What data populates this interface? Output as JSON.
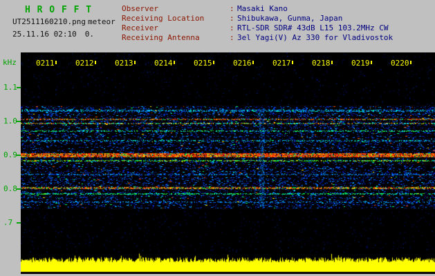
{
  "header": {
    "app_title": "H R O F F T",
    "filename": "UT2511160210.png",
    "mode": "meteor",
    "timestamp": "25.11.16 02:10",
    "counter": "0.",
    "info": [
      {
        "label": "Observer",
        "sep": ":",
        "value": "Masaki Kano"
      },
      {
        "label": "Receiving Location",
        "sep": ":",
        "value": "Shibukawa, Gunma, Japan"
      },
      {
        "label": "Receiver",
        "sep": ":",
        "value": "RTL-SDR SDR# 43dB L15 103.2MHz CW"
      },
      {
        "label": "Receiving Antenna",
        "sep": ":",
        "value": "3el Yagi(V) Az 330 for Vladivostok"
      }
    ]
  },
  "spectrogram": {
    "unit_label": "kHz",
    "y_ticks": [
      {
        "label": "1.1",
        "khz": 1.1
      },
      {
        "label": "1.0",
        "khz": 1.0
      },
      {
        "label": "0.9",
        "khz": 0.9
      },
      {
        "label": "0.8",
        "khz": 0.8
      },
      {
        "label": ".7",
        "khz": 0.7
      }
    ],
    "time_labels": [
      "0211",
      "0212",
      "0213",
      "0214",
      "0215",
      "0216",
      "0217",
      "0218",
      "0219",
      "0220"
    ],
    "colors": {
      "plot_background": "#000000",
      "axis_text": "#00a400",
      "time_text": "#ffff00",
      "signal_trace": "#ffff00"
    },
    "freq_axis_khz": {
      "top": 1.204,
      "bottom": 0.612
    },
    "noise_band_khz": {
      "high": 1.045,
      "low": 0.742
    },
    "carriers": [
      {
        "khz": 1.032,
        "thickness": 3,
        "prob": 0.5,
        "palette": [
          "#0066ff",
          "#00aaff",
          "#00ddff",
          "#0044dd",
          "#00ff99"
        ]
      },
      {
        "khz": 1.006,
        "thickness": 2,
        "prob": 0.55,
        "palette": [
          "#ff4400",
          "#ff7700",
          "#ffaa00",
          "#00ff66",
          "#ff2a00"
        ]
      },
      {
        "khz": 0.994,
        "thickness": 2,
        "prob": 0.5,
        "palette": [
          "#ff5500",
          "#ffcc00",
          "#00ff66",
          "#00ddff"
        ]
      },
      {
        "khz": 0.972,
        "thickness": 2,
        "prob": 0.45,
        "palette": [
          "#00ee66",
          "#33ff33",
          "#00ccff"
        ]
      },
      {
        "khz": 0.942,
        "thickness": 2,
        "prob": 0.4,
        "palette": [
          "#0077ff",
          "#00ccff",
          "#00ff99"
        ]
      },
      {
        "khz": 0.9,
        "thickness": 6,
        "prob": 0.82,
        "palette": [
          "#ff2a00",
          "#ff2a00",
          "#ff2a00",
          "#dd1c00",
          "#ff6600",
          "#ff9900",
          "#ffd000",
          "#00ff55"
        ]
      },
      {
        "khz": 0.884,
        "thickness": 2,
        "prob": 0.55,
        "palette": [
          "#00ff55",
          "#66ff00",
          "#00cc88",
          "#ffee00"
        ]
      },
      {
        "khz": 0.842,
        "thickness": 2,
        "prob": 0.35,
        "palette": [
          "#0088ff",
          "#00ccff",
          "#0055dd"
        ]
      },
      {
        "khz": 0.802,
        "thickness": 3,
        "prob": 0.6,
        "palette": [
          "#ff3300",
          "#ff7700",
          "#ffbb00",
          "#00ff55"
        ]
      },
      {
        "khz": 0.786,
        "thickness": 2,
        "prob": 0.5,
        "palette": [
          "#00ff66",
          "#00ddff",
          "#33ff33"
        ]
      },
      {
        "khz": 0.762,
        "thickness": 2,
        "prob": 0.35,
        "palette": [
          "#0077ff",
          "#00bbff"
        ]
      }
    ],
    "event_streak": {
      "x_fraction": 0.581,
      "khz_high": 1.04,
      "khz_low": 0.75
    },
    "signal_strip": {
      "base_level": 14,
      "jitter": 7,
      "bottom_margin": 3
    }
  }
}
